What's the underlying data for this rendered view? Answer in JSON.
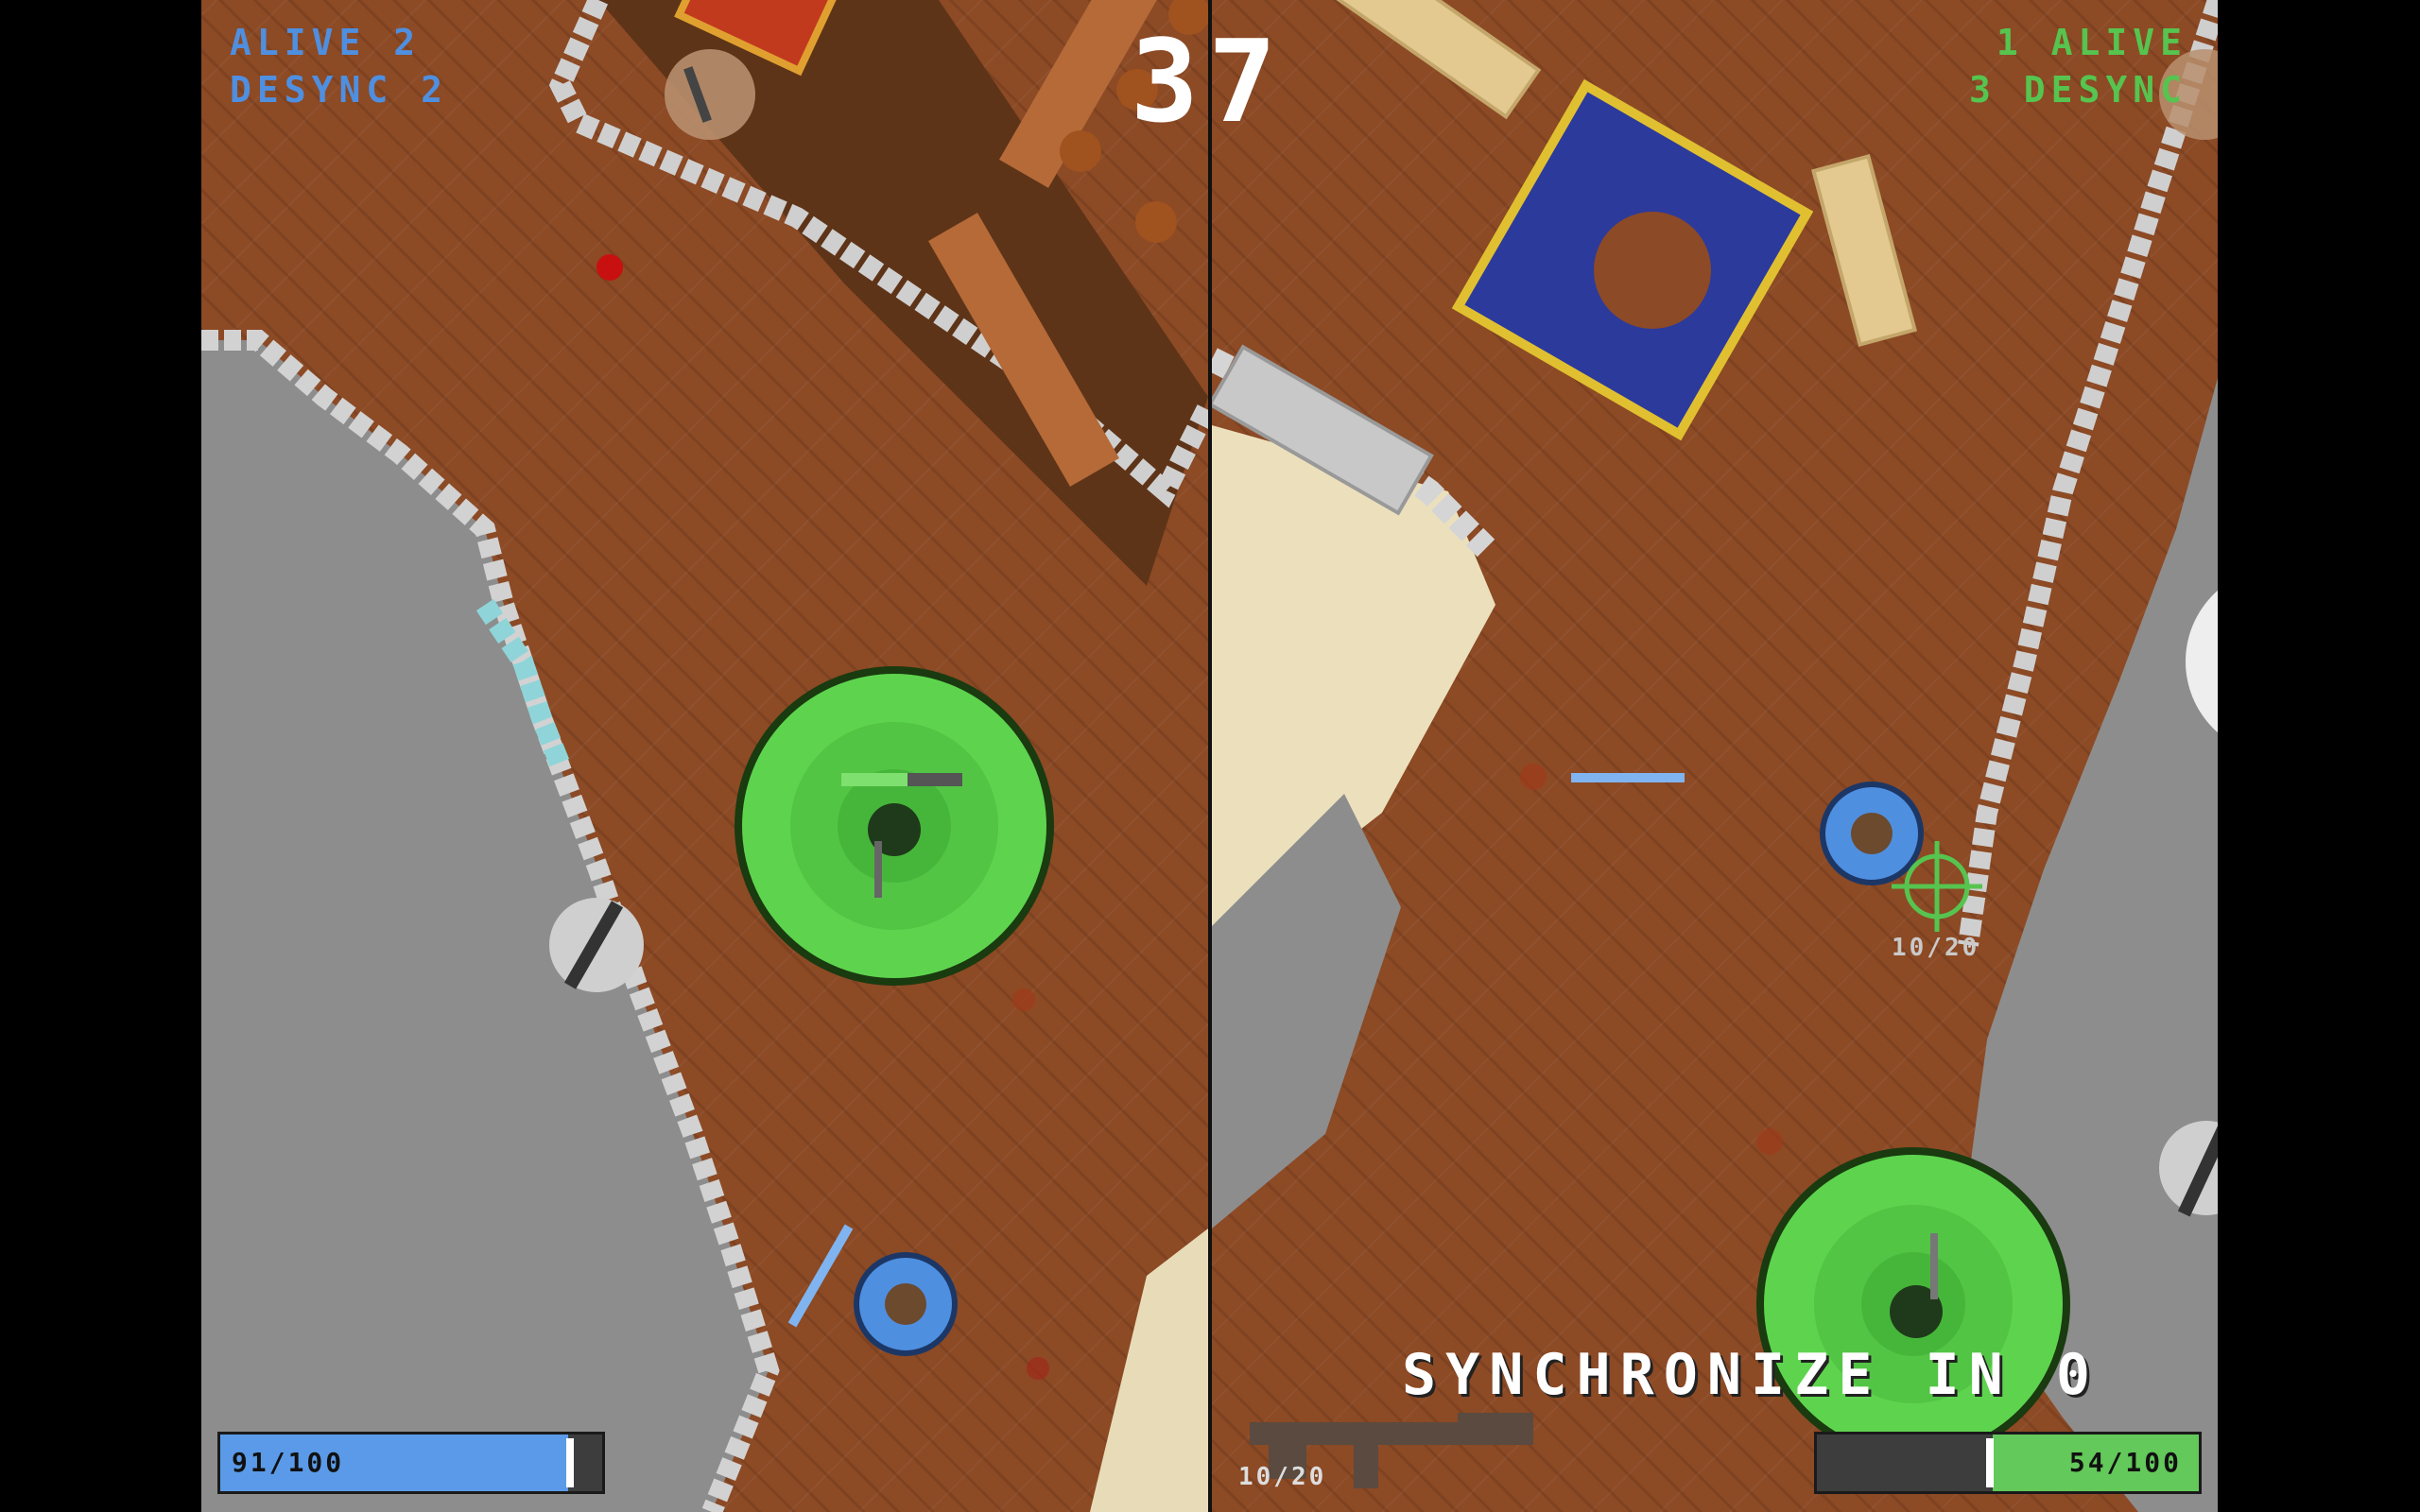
{
  "hud": {
    "left": {
      "alive_label": "ALIVE 2",
      "desync_label": "DESYNC 2",
      "color": "#4f8fe0"
    },
    "right": {
      "alive_label": "1 ALIVE",
      "desync_label": "3 DESYNC",
      "color": "#56c44f"
    },
    "timer": "37"
  },
  "players": {
    "left": {
      "health_text": "91/100",
      "health": 91,
      "max_health": 100,
      "bar_color": "#5b9ae8"
    },
    "right": {
      "health_text": "54/100",
      "health": 54,
      "max_health": 100,
      "bar_color": "#63c95a"
    }
  },
  "ammo": {
    "hud_text": "10/20",
    "world_text": "10/20",
    "weapon_icon": "assault-rifle-icon"
  },
  "status": {
    "sync_message": "SYNCHRONIZE IN 0"
  },
  "colors": {
    "floor": "#8c4a25",
    "stone": "#8a8a8a",
    "zone": "#5ed44e",
    "blue_team": "#4f8fe0",
    "green_team": "#56c44f"
  }
}
